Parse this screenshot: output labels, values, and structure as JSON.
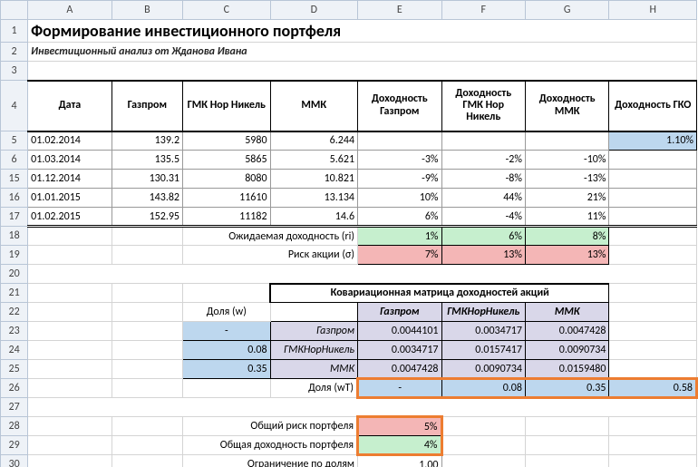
{
  "cols": [
    "A",
    "B",
    "C",
    "D",
    "E",
    "F",
    "G",
    "H"
  ],
  "title": "Формирование инвестиционного портфеля",
  "subtitle": "Инвестиционный анализ от Жданова Ивана",
  "headers": {
    "A": "Дата",
    "B": "Газпром",
    "C": "ГМК Нор Никель",
    "D": "ММК",
    "E": "Доходность Газпром",
    "F": "Доходность ГМК Нор Никель",
    "G": "Доходность ММК",
    "H": "Доходность ГКО"
  },
  "rows": [
    {
      "n": "5",
      "A": "01.02.2014",
      "B": "139.2",
      "C": "5980",
      "D": "6.244",
      "E": "",
      "F": "",
      "G": "",
      "H": "1.10%"
    },
    {
      "n": "6",
      "A": "01.03.2014",
      "B": "135.5",
      "C": "5865",
      "D": "5.621",
      "E": "-3%",
      "F": "-2%",
      "G": "-10%",
      "H": ""
    },
    {
      "n": "15",
      "A": "01.12.2014",
      "B": "130.31",
      "C": "8080",
      "D": "10.821",
      "E": "-9%",
      "F": "-8%",
      "G": "-13%",
      "H": ""
    },
    {
      "n": "16",
      "A": "01.01.2015",
      "B": "143.82",
      "C": "11610",
      "D": "13.134",
      "E": "10%",
      "F": "44%",
      "G": "21%",
      "H": ""
    },
    {
      "n": "17",
      "A": "01.02.2015",
      "B": "152.95",
      "C": "11182",
      "D": "14.6",
      "E": "6%",
      "F": "-4%",
      "G": "11%",
      "H": ""
    }
  ],
  "exp": {
    "label": "Ожидаемая доходность (ri)",
    "E": "1%",
    "F": "6%",
    "G": "8%"
  },
  "risk": {
    "label": "Риск акции (σ)",
    "E": "7%",
    "F": "13%",
    "G": "13%"
  },
  "covTitle": "Ковариационная матрица доходностей акций",
  "wLabel": "Доля (w)",
  "wtLabel": "Доля (wT)",
  "covCols": {
    "E": "Газпром",
    "F": "ГМКНорНикель",
    "G": "ММК"
  },
  "covRows": [
    {
      "n": "23",
      "w": "-",
      "name": "Газпром",
      "E": "0.0044101",
      "F": "0.0034717",
      "G": "0.0047428"
    },
    {
      "n": "24",
      "w": "0.08",
      "name": "ГМКНорНикель",
      "E": "0.0034717",
      "F": "0.0157417",
      "G": "0.0090734"
    },
    {
      "n": "25",
      "w": "0.35",
      "name": "ММК",
      "E": "0.0047428",
      "F": "0.0090734",
      "G": "0.0159480"
    }
  ],
  "wt": {
    "E": "-",
    "F": "0.08",
    "G": "0.35",
    "H": "0.58"
  },
  "portRisk": {
    "label": "Общий риск портфеля",
    "val": "5%"
  },
  "portRet": {
    "label": "Общая доходность портфеля",
    "val": "4%"
  },
  "constraint": {
    "label": "Ограничение по долям",
    "val": "1.00"
  }
}
